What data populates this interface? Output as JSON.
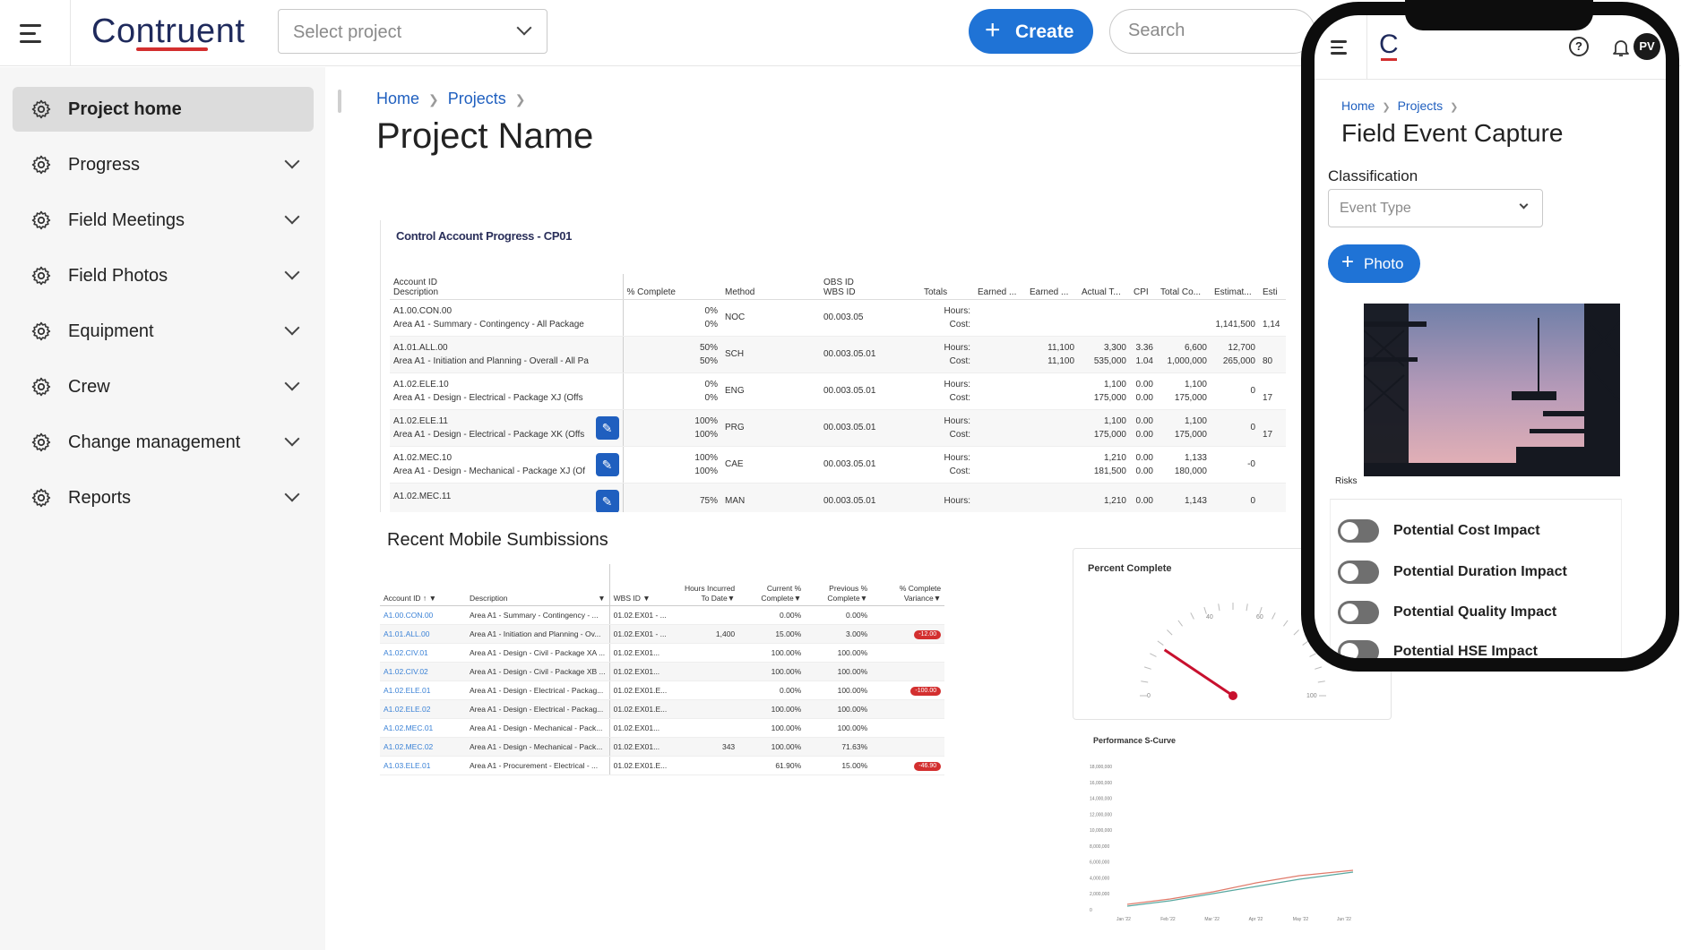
{
  "app": {
    "logo": "Contruent"
  },
  "topbar": {
    "select_project_placeholder": "Select project",
    "create_label": "Create",
    "search_placeholder": "Search"
  },
  "sidebar": {
    "items": [
      {
        "label": "Project home",
        "active": true
      },
      {
        "label": "Progress"
      },
      {
        "label": "Field Meetings"
      },
      {
        "label": "Field Photos"
      },
      {
        "label": "Equipment"
      },
      {
        "label": "Crew"
      },
      {
        "label": "Change management"
      },
      {
        "label": "Reports"
      }
    ]
  },
  "breadcrumb": {
    "home": "Home",
    "projects": "Projects"
  },
  "page_title": "Project Name",
  "control_account": {
    "title": "Control Account Progress - CP01",
    "headers": {
      "account_id": "Account ID",
      "description": "Description",
      "pct_complete": "% Complete",
      "method": "Method",
      "obs_id": "OBS ID",
      "wbs_id": "WBS ID",
      "totals": "Totals",
      "earned1": "Earned ...",
      "earned2": "Earned ...",
      "actual": "Actual T...",
      "cpi": "CPI",
      "total_co": "Total Co...",
      "estimat": "Estimat...",
      "est2": "Esti"
    },
    "rows": [
      {
        "id": "A1.00.CON.00",
        "desc": "Area A1 - Summary - Contingency - All Package",
        "pct1": "0%",
        "pct2": "0%",
        "method": "NOC",
        "obs": "00.003.05",
        "t1": "Hours:",
        "t2": "Cost:",
        "earned": "",
        "actual1": "",
        "actual2": "",
        "cpi1": "",
        "cpi2": "",
        "total1": "",
        "total2": "",
        "est1": "",
        "est2": "1,141,500",
        "x2": "1,14"
      },
      {
        "id": "A1.01.ALL.00",
        "desc": "Area A1 - Initiation and Planning - Overall - All Pa",
        "pct1": "50%",
        "pct2": "50%",
        "method": "SCH",
        "obs": "00.003.05.01",
        "t1": "Hours:",
        "t2": "Cost:",
        "earned1": "11,100",
        "earned2": "11,100",
        "actual1": "3,300",
        "actual2": "535,000",
        "cpi1": "3.36",
        "cpi2": "1.04",
        "total1": "6,600",
        "total2": "1,000,000",
        "est1": "12,700",
        "est2": "265,000",
        "x2": "80"
      },
      {
        "id": "A1.02.ELE.10",
        "desc": "Area A1 - Design - Electrical - Package XJ (Offs",
        "pct1": "0%",
        "pct2": "0%",
        "method": "ENG",
        "obs": "00.003.05.01",
        "t1": "Hours:",
        "t2": "Cost:",
        "earned1": "",
        "earned2": "",
        "actual1": "1,100",
        "actual2": "175,000",
        "cpi1": "0.00",
        "cpi2": "0.00",
        "total1": "1,100",
        "total2": "175,000",
        "est1": "0",
        "est2": "",
        "x2": "17"
      },
      {
        "id": "A1.02.ELE.11",
        "desc": "Area A1 - Design - Electrical - Package XK (Offs",
        "pct1": "100%",
        "pct2": "100%",
        "method": "PRG",
        "obs": "00.003.05.01",
        "t1": "Hours:",
        "t2": "Cost:",
        "earned1": "",
        "earned2": "",
        "actual1": "1,100",
        "actual2": "175,000",
        "cpi1": "0.00",
        "cpi2": "0.00",
        "total1": "1,100",
        "total2": "175,000",
        "est1": "0",
        "est2": "",
        "x2": "17"
      },
      {
        "id": "A1.02.MEC.10",
        "desc": "Area A1 - Design - Mechanical - Package XJ (Of",
        "pct1": "100%",
        "pct2": "100%",
        "method": "CAE",
        "obs": "00.003.05.01",
        "t1": "Hours:",
        "t2": "Cost:",
        "earned1": "",
        "earned2": "",
        "actual1": "1,210",
        "actual2": "181,500",
        "cpi1": "0.00",
        "cpi2": "0.00",
        "total1": "1,133",
        "total2": "180,000",
        "est1": "-0",
        "est2": "",
        "x2": ""
      },
      {
        "id": "A1.02.MEC.11",
        "desc": "",
        "pct1": "75%",
        "pct2": "",
        "method": "MAN",
        "obs": "00.003.05.01",
        "t1": "Hours:",
        "t2": "",
        "earned1": "",
        "earned2": "",
        "actual1": "1,210",
        "actual2": "",
        "cpi1": "0.00",
        "cpi2": "",
        "total1": "1,143",
        "total2": "",
        "est1": "0",
        "est2": "",
        "x2": ""
      }
    ]
  },
  "recent": {
    "title": "Recent Mobile Sumbissions",
    "headers": {
      "account_id": "Account ID ↑",
      "description": "Description",
      "wbs_id": "WBS ID",
      "hours": "Hours Incurred To Date",
      "current": "Current % Complete",
      "previous": "Previous % Complete",
      "variance": "% Complete Variance"
    },
    "rows": [
      {
        "id": "A1.00.CON.00",
        "desc": "Area A1 - Summary - Contingency - ...",
        "wbs": "01.02.EX01 - ...",
        "hours": "",
        "current": "0.00%",
        "previous": "0.00%",
        "variance": ""
      },
      {
        "id": "A1.01.ALL.00",
        "desc": "Area A1 - Initiation and Planning - Ov...",
        "wbs": "01.02.EX01 - ...",
        "hours": "1,400",
        "current": "15.00%",
        "previous": "3.00%",
        "variance": "-12.00"
      },
      {
        "id": "A1.02.CIV.01",
        "desc": "Area A1 - Design - Civil - Package XA ...",
        "wbs": "01.02.EX01...",
        "hours": "",
        "current": "100.00%",
        "previous": "100.00%",
        "variance": ""
      },
      {
        "id": "A1.02.CIV.02",
        "desc": "Area A1 - Design - Civil - Package XB ...",
        "wbs": "01.02.EX01...",
        "hours": "",
        "current": "100.00%",
        "previous": "100.00%",
        "variance": ""
      },
      {
        "id": "A1.02.ELE.01",
        "desc": "Area A1 - Design - Electrical - Packag...",
        "wbs": "01.02.EX01.E...",
        "hours": "",
        "current": "0.00%",
        "previous": "100.00%",
        "variance": "-100.00"
      },
      {
        "id": "A1.02.ELE.02",
        "desc": "Area A1 - Design - Electrical - Packag...",
        "wbs": "01.02.EX01.E...",
        "hours": "",
        "current": "100.00%",
        "previous": "100.00%",
        "variance": ""
      },
      {
        "id": "A1.02.MEC.01",
        "desc": "Area A1 - Design - Mechanical - Pack...",
        "wbs": "01.02.EX01...",
        "hours": "",
        "current": "100.00%",
        "previous": "100.00%",
        "variance": ""
      },
      {
        "id": "A1.02.MEC.02",
        "desc": "Area A1 - Design - Mechanical - Pack...",
        "wbs": "01.02.EX01...",
        "hours": "343",
        "current": "100.00%",
        "previous": "71.63%",
        "variance": ""
      },
      {
        "id": "A1.03.ELE.01",
        "desc": "Area A1 - Procurement - Electrical - ...",
        "wbs": "01.02.EX01.E...",
        "hours": "",
        "current": "61.90%",
        "previous": "15.00%",
        "variance": "-46.90"
      }
    ]
  },
  "gauge": {
    "title": "Percent Complete",
    "ticks": [
      "0",
      "40",
      "60",
      "100"
    ],
    "value_pct": 15
  },
  "scurve": {
    "title": "Performance S-Curve",
    "yticks": [
      "18,000,000",
      "16,000,000",
      "14,000,000",
      "12,000,000",
      "10,000,000",
      "8,000,000",
      "6,000,000",
      "4,000,000",
      "2,000,000",
      "0"
    ],
    "xticks": [
      "Jan '22",
      "Feb '22",
      "Mar '22",
      "Apr '22",
      "May '22",
      "Jun '22"
    ]
  },
  "phone": {
    "logo": "C",
    "avatar": "PV",
    "help": "?",
    "breadcrumb": {
      "home": "Home",
      "projects": "Projects"
    },
    "title": "Field Event Capture",
    "classification_label": "Classification",
    "event_type_placeholder": "Event Type",
    "photo_label": "Photo",
    "risks_label": "Risks",
    "risks": [
      {
        "label": "Potential  Cost Impact"
      },
      {
        "label": "Potential  Duration Impact"
      },
      {
        "label": "Potential  Quality Impact"
      },
      {
        "label": "Potential  HSE Impact"
      }
    ]
  },
  "colors": {
    "accent": "#1f73d6",
    "brand": "#1f2a5c",
    "brand_red": "#d32f2f",
    "link": "#1f5fbf"
  }
}
